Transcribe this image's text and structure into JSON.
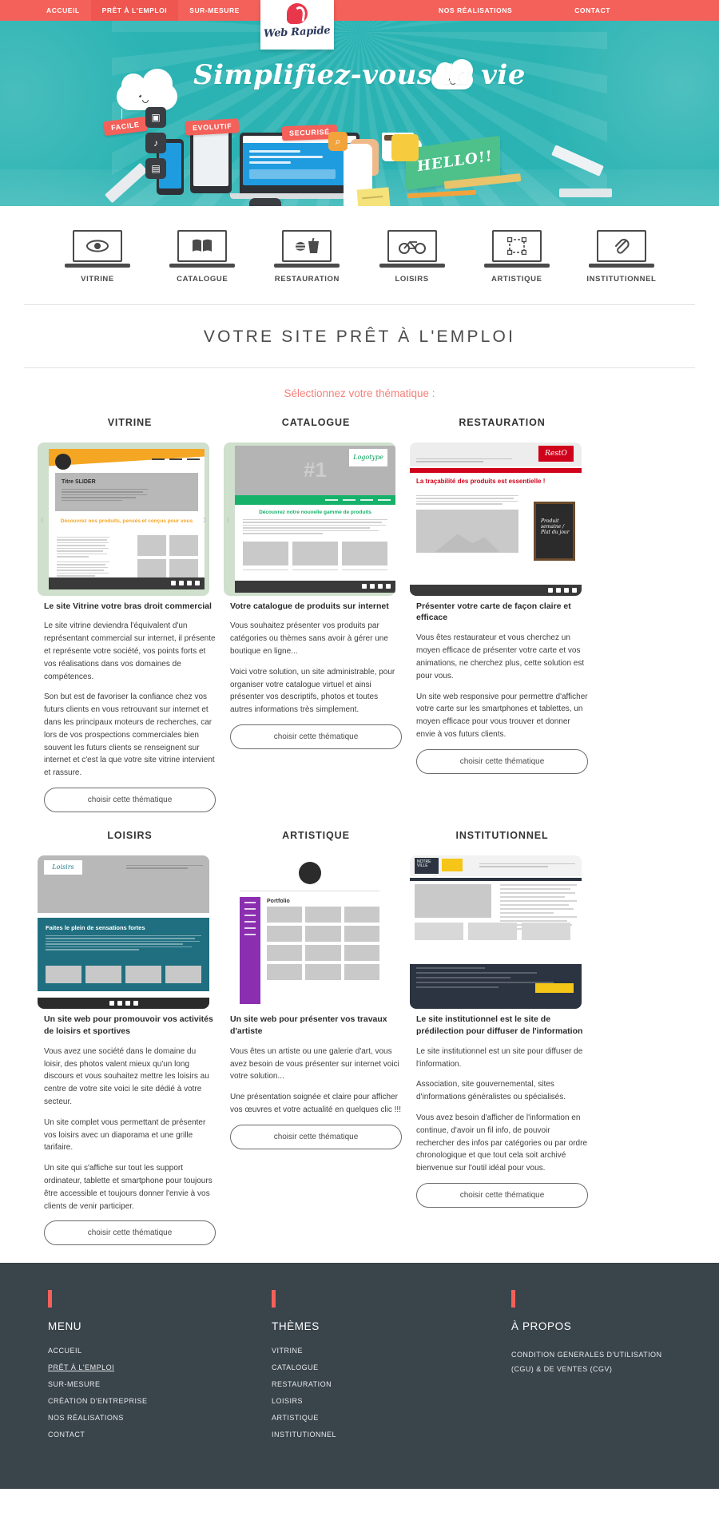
{
  "brand": {
    "name": "Web Rapide",
    "logo_icon": "speech-bubble-logo-icon"
  },
  "nav": {
    "left_items": [
      {
        "label": "ACCUEIL",
        "active": false
      },
      {
        "label": "PRÊT À L'EMPLOI",
        "active": true
      },
      {
        "label": "SUR-MESURE",
        "active": false
      }
    ],
    "right_items": [
      {
        "label": "NOS RÉALISATIONS",
        "active": false
      },
      {
        "label": "CONTACT",
        "active": false
      }
    ]
  },
  "hero": {
    "headline": "Simplifiez-vous la vie",
    "tags": [
      "FACILE",
      "EVOLUTIF",
      "SECURISÉ"
    ],
    "board_text": "HELLO!!",
    "accent_teal": "#2bb3b3",
    "accent_red": "#f4615a"
  },
  "categories": [
    {
      "label": "VITRINE",
      "icon": "eye-icon"
    },
    {
      "label": "CATALOGUE",
      "icon": "book-icon"
    },
    {
      "label": "RESTAURATION",
      "icon": "burger-drink-icon"
    },
    {
      "label": "LOISIRS",
      "icon": "bicycle-icon"
    },
    {
      "label": "ARTISTIQUE",
      "icon": "crop-frame-icon"
    },
    {
      "label": "INSTITUTIONNEL",
      "icon": "paperclip-icon"
    }
  ],
  "page": {
    "title": "VOTRE SITE PRÊT À L'EMPLOI",
    "subtitle": "Sélectionnez votre thématique :"
  },
  "button_label": "choisir cette thématique",
  "cards": [
    {
      "title": "VITRINE",
      "heading": "Le site Vitrine votre bras droit commercial",
      "paragraphs": [
        "Le site vitrine deviendra l'équivalent d'un représentant commercial sur internet, il présente et représente votre société, vos points forts et vos réalisations dans vos domaines de compétences.",
        "Son but est de favoriser la confiance chez vos futurs clients en vous retrouvant sur internet et dans les principaux moteurs de recherches, car lors de vos prospections commerciales bien souvent les futurs clients se renseignent sur internet et c'est la que votre site vitrine intervient et rassure."
      ],
      "mockup": {
        "name": "vitrine-mockup",
        "slider_title": "Titre SLIDER",
        "tagline": "Découvrez nos produits, pensés et conçus pour vous"
      }
    },
    {
      "title": "CATALOGUE",
      "heading": "Votre catalogue de produits sur internet",
      "paragraphs": [
        "Vous souhaitez présenter vos produits par catégories ou thèmes sans avoir à gérer une boutique en ligne...",
        "Voici votre solution, un site administrable, pour organiser votre catalogue virtuel et ainsi présenter vos descriptifs, photos et toutes autres informations très simplement."
      ],
      "mockup": {
        "name": "catalogue-mockup",
        "hero_text": "#1",
        "tagline": "Découvrez notre nouvelle gamme de produits"
      }
    },
    {
      "title": "RESTAURATION",
      "heading": "Présenter votre carte de façon claire et efficace",
      "paragraphs": [
        "Vous êtes restaurateur et vous cherchez un moyen efficace de présenter votre carte et vos animations, ne cherchez plus, cette solution est pour vous.",
        "Un site web responsive pour permettre d'afficher votre carte sur les smartphones et tablettes, un moyen efficace pour vous trouver et donner envie à vos futurs clients."
      ],
      "mockup": {
        "name": "restauration-mockup",
        "headline": "La traçabilité des produits est essentielle !",
        "board_text": "Produit  semaine / Plat  du jour"
      }
    },
    {
      "title": "LOISIRS",
      "heading": "Un site web pour promouvoir vos activités de loisirs et sportives",
      "paragraphs": [
        "Vous avez une société dans le domaine du loisir, des photos valent mieux qu'un long discours et vous souhaitez mettre les loisirs au centre de votre site voici le site dédié à votre secteur.",
        "Un site complet vous permettant de présenter vos loisirs avec un diaporama et une grille tarifaire.",
        "Un site qui s'affiche sur tout les support ordinateur, tablette et smartphone pour toujours être accessible et toujours donner l'envie à vos clients de venir participer."
      ],
      "mockup": {
        "name": "loisirs-mockup",
        "headline": "Faites le plein de sensations fortes"
      }
    },
    {
      "title": "ARTISTIQUE",
      "heading": "Un site web pour présenter vos travaux d'artiste",
      "paragraphs": [
        "Vous êtes un artiste ou une galerie d'art, vous avez besoin de vous présenter sur internet voici votre solution...",
        "Une présentation soignée et claire pour afficher vos œuvres et votre actualité en quelques clic !!!"
      ],
      "mockup": {
        "name": "artistique-mockup",
        "section_label": "Portfolio"
      }
    },
    {
      "title": "INSTITUTIONNEL",
      "heading": "Le site institutionnel est le site de prédilection pour diffuser de l'information",
      "paragraphs": [
        "Le site institutionnel est un site pour diffuser de l'information.",
        "Association, site gouvernemental, sites d'informations généralistes ou spécialisés.",
        "Vous avez besoin d'afficher de l'information en continue, d'avoir un fil info, de pouvoir rechercher des infos par catégories ou par ordre chronologique et que tout cela soit archivé bienvenue sur l'outil idéal pour vous."
      ],
      "mockup": {
        "name": "institutionnel-mockup"
      }
    }
  ],
  "footer": {
    "columns": [
      {
        "heading": "MENU",
        "links": [
          {
            "label": "ACCUEIL",
            "underline": false
          },
          {
            "label": "PRÊT À L'EMPLOI",
            "underline": true
          },
          {
            "label": "SUR-MESURE",
            "underline": false
          },
          {
            "label": "CRÉATION D'ENTREPRISE",
            "underline": false
          },
          {
            "label": "NOS RÉALISATIONS",
            "underline": false
          },
          {
            "label": "CONTACT",
            "underline": false
          }
        ]
      },
      {
        "heading": "THÈMES",
        "links": [
          {
            "label": "VITRINE",
            "underline": false
          },
          {
            "label": "CATALOGUE",
            "underline": false
          },
          {
            "label": "RESTAURATION",
            "underline": false
          },
          {
            "label": "LOISIRS",
            "underline": false
          },
          {
            "label": "ARTISTIQUE",
            "underline": false
          },
          {
            "label": "INSTITUTIONNEL",
            "underline": false
          }
        ]
      },
      {
        "heading": "À PROPOS",
        "text": "CONDITION GENERALES D'UTILISATION (CGU) & DE VENTES (CGV)"
      }
    ]
  }
}
